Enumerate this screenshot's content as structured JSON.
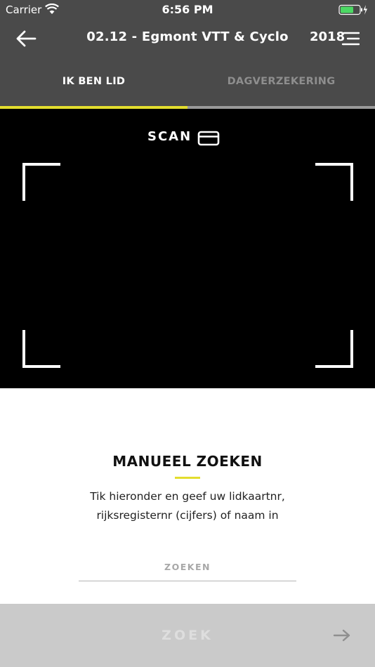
{
  "status_bar": {
    "carrier": "Carrier",
    "time": "6:56 PM"
  },
  "header": {
    "back_icon": "arrow-left-icon",
    "title": "02.12 - Egmont VTT & Cyclo",
    "year": "2018",
    "menu_icon": "menu-icon"
  },
  "tabs": [
    {
      "label": "IK BEN LID",
      "active": true
    },
    {
      "label": "DAGVERZEKERING",
      "active": false
    }
  ],
  "scanner": {
    "label": "SCAN",
    "icon": "card-icon"
  },
  "manual": {
    "title": "MANUEEL ZOEKEN",
    "description_line1": "Tik hieronder en geef uw lidkaartnr,",
    "description_line2": "rijksregisternr (cijfers) of naam in",
    "search_placeholder": "ZOEKEN",
    "search_value": ""
  },
  "search_button": {
    "label": "ZOEK",
    "icon": "arrow-right-icon"
  },
  "colors": {
    "header_bg": "#4a4a4a",
    "accent": "#e3dd2e",
    "scanner_bg": "#000000",
    "button_bg": "#cacaca"
  }
}
